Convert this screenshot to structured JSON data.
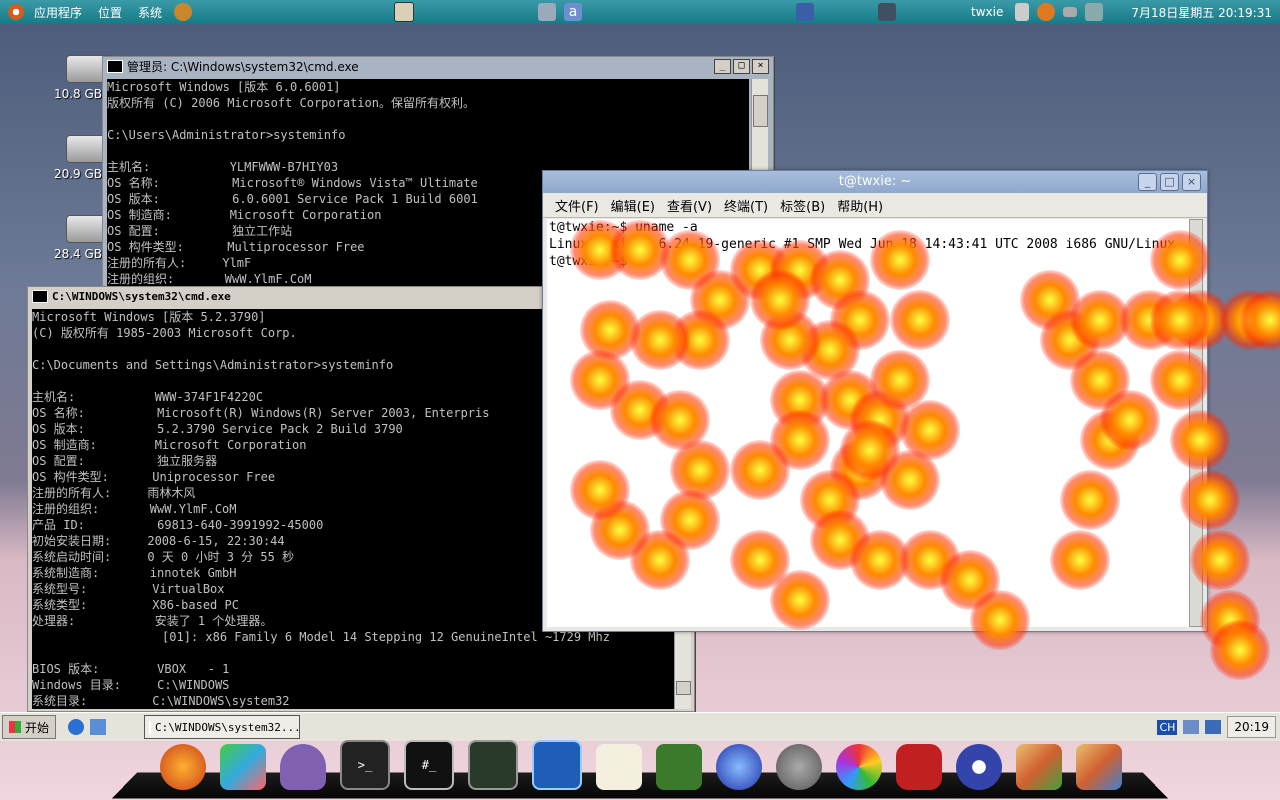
{
  "top_panel": {
    "menus": [
      "应用程序",
      "位置",
      "系统"
    ],
    "user": "twxie",
    "datetime": "7月18日星期五 20:19:31"
  },
  "drives": [
    {
      "label": "10.8 GB"
    },
    {
      "label": "20.9 GB"
    },
    {
      "label": "28.4 GB"
    }
  ],
  "vista_cmd": {
    "title": "管理员: C:\\Windows\\system32\\cmd.exe",
    "lines": [
      "Microsoft Windows [版本 6.0.6001]",
      "版权所有 (C) 2006 Microsoft Corporation。保留所有权利。",
      "",
      "C:\\Users\\Administrator>systeminfo",
      "",
      "主机名:           YLMFWWW-B7HIY03",
      "OS 名称:          Microsoft® Windows Vista™ Ultimate",
      "OS 版本:          6.0.6001 Service Pack 1 Build 6001",
      "OS 制造商:        Microsoft Corporation",
      "OS 配置:          独立工作站",
      "OS 构件类型:      Multiprocessor Free",
      "注册的所有人:     YlmF",
      "注册的组织:       WwW.YlmF.CoM"
    ]
  },
  "xp_cmd": {
    "title": "C:\\WINDOWS\\system32\\cmd.exe",
    "lines": [
      "Microsoft Windows [版本 5.2.3790]",
      "(C) 版权所有 1985-2003 Microsoft Corp.",
      "",
      "C:\\Documents and Settings\\Administrator>systeminfo",
      "",
      "主机名:           WWW-374F1F4220C",
      "OS 名称:          Microsoft(R) Windows(R) Server 2003, Enterpris",
      "OS 版本:          5.2.3790 Service Pack 2 Build 3790",
      "OS 制造商:        Microsoft Corporation",
      "OS 配置:          独立服务器",
      "OS 构件类型:      Uniprocessor Free",
      "注册的所有人:     雨林木风",
      "注册的组织:       WwW.YlmF.CoM",
      "产品 ID:          69813-640-3991992-45000",
      "初始安装日期:     2008-6-15, 22:30:44",
      "系统启动时间:     0 天 0 小时 3 分 55 秒",
      "系统制造商:       innotek GmbH",
      "系统型号:         VirtualBox",
      "系统类型:         X86-based PC",
      "处理器:           安装了 1 个处理器。",
      "                  [01]: x86 Family 6 Model 14 Stepping 12 GenuineIntel ~1729 Mhz",
      "",
      "BIOS 版本:        VBOX   - 1",
      "Windows 目录:     C:\\WINDOWS",
      "系统目录:         C:\\WINDOWS\\system32"
    ]
  },
  "terminal": {
    "title": "t@twxie: ~",
    "menus": [
      "文件(F)",
      "编辑(E)",
      "查看(V)",
      "终端(T)",
      "标签(B)",
      "帮助(H)"
    ],
    "lines": [
      "t@twxie:~$ uname -a",
      "Linux twxie 2.6.24-19-generic #1 SMP Wed Jun 18 14:43:41 UTC 2008 i686 GNU/Linux",
      "t@twxie:~$ "
    ]
  },
  "xp_taskbar": {
    "start_label": "开始",
    "task_label": "C:\\WINDOWS\\system32...",
    "lang": "CH",
    "clock": "20:19"
  },
  "colors": {
    "glow_core": "#ffff40",
    "glow_mid": "#ff8a00",
    "glow_outer": "#ff2a00"
  }
}
